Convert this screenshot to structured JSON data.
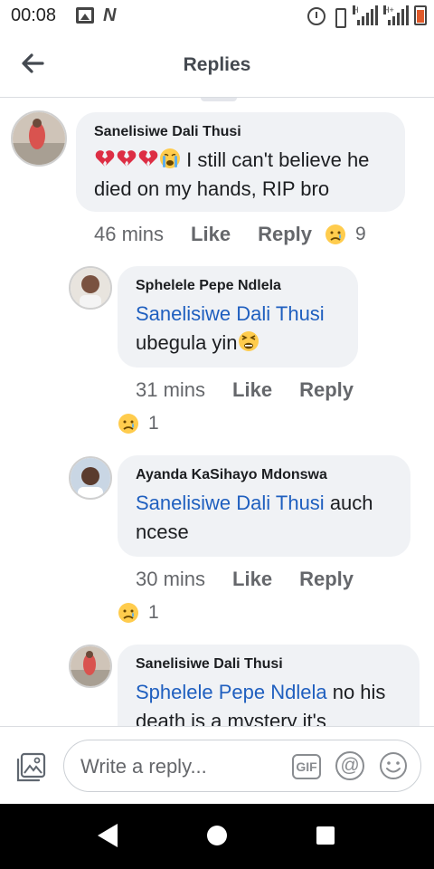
{
  "status_bar": {
    "time": "00:08",
    "icons": [
      "gallery-icon",
      "n-app-icon",
      "alarm-icon",
      "vibrate-icon",
      "signal-h-icon",
      "signal-hplus-icon",
      "battery-low-icon"
    ],
    "network_h": "H",
    "network_hplus": "H+",
    "battery_color": "#e05a2a"
  },
  "header": {
    "title": "Replies",
    "back_icon": "arrow-left-icon"
  },
  "comments": [
    {
      "author": "Sanelisiwe Dali Thusi",
      "emojis": [
        "broken-heart",
        "broken-heart",
        "broken-heart",
        "crying-face"
      ],
      "text": " I still can't believe he died on my hands, RIP bro",
      "time": "46 mins",
      "like": "Like",
      "reply": "Reply",
      "reaction_count": "9"
    },
    {
      "author": "Sphelele Pepe Ndlela",
      "mention": "Sanelisiwe Dali Thusi",
      "text": "ubegula yin",
      "trailing_emoji": "weary-face",
      "time": "31 mins",
      "like": "Like",
      "reply": "Reply",
      "reaction_count": "1"
    },
    {
      "author": "Ayanda KaSihayo Mdonswa",
      "mention": "Sanelisiwe Dali Thusi",
      "text": " auch ncese",
      "time": "30 mins",
      "like": "Like",
      "reply": "Reply",
      "reaction_count": "1"
    },
    {
      "author": "Sanelisiwe Dali Thusi",
      "mention": "Sphelele Pepe Ndlela",
      "text": "  no his death is a mystery it's"
    }
  ],
  "composer": {
    "placeholder": "Write a reply...",
    "gif_label": "GIF",
    "at_label": "@"
  },
  "colors": {
    "mention": "#1f5fbf",
    "bubble": "#f0f2f5",
    "meta_text": "#65676b"
  }
}
